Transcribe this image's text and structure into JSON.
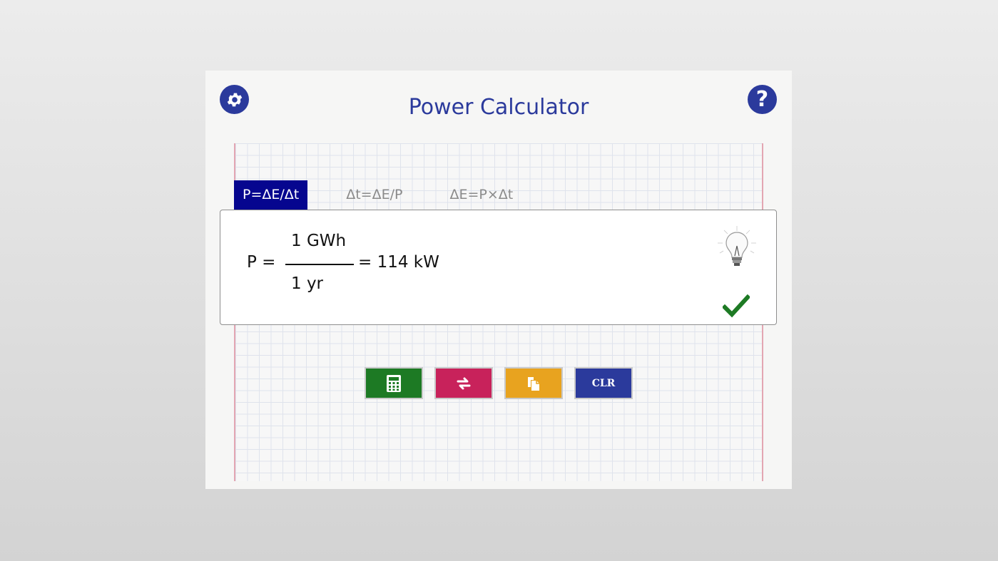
{
  "header": {
    "title": "Power Calculator"
  },
  "tabs": [
    {
      "label": "P=ΔE/Δt",
      "active": true
    },
    {
      "label": "Δt=ΔE/P",
      "active": false
    },
    {
      "label": "ΔE=P×Δt",
      "active": false
    }
  ],
  "result": {
    "lhs": "P =",
    "numerator": "1 GWh",
    "denominator": "1 yr",
    "rhs": "= 114 kW"
  },
  "actions": {
    "clear_label": "CLR"
  },
  "icons": {
    "settings": "gear-icon",
    "help": "question-mark-icon",
    "bulb": "lightbulb-icon",
    "check": "checkmark-icon",
    "calculate": "calculator-icon",
    "swap": "swap-arrows-icon",
    "copy": "copy-icon"
  },
  "colors": {
    "accent": "#2b3a9c",
    "active_tab": "#06068f",
    "calculate_button": "#1d7a24",
    "swap_button": "#c8225b",
    "copy_button": "#e8a31f",
    "clear_button": "#2b3a9c",
    "check": "#1d7a24"
  }
}
